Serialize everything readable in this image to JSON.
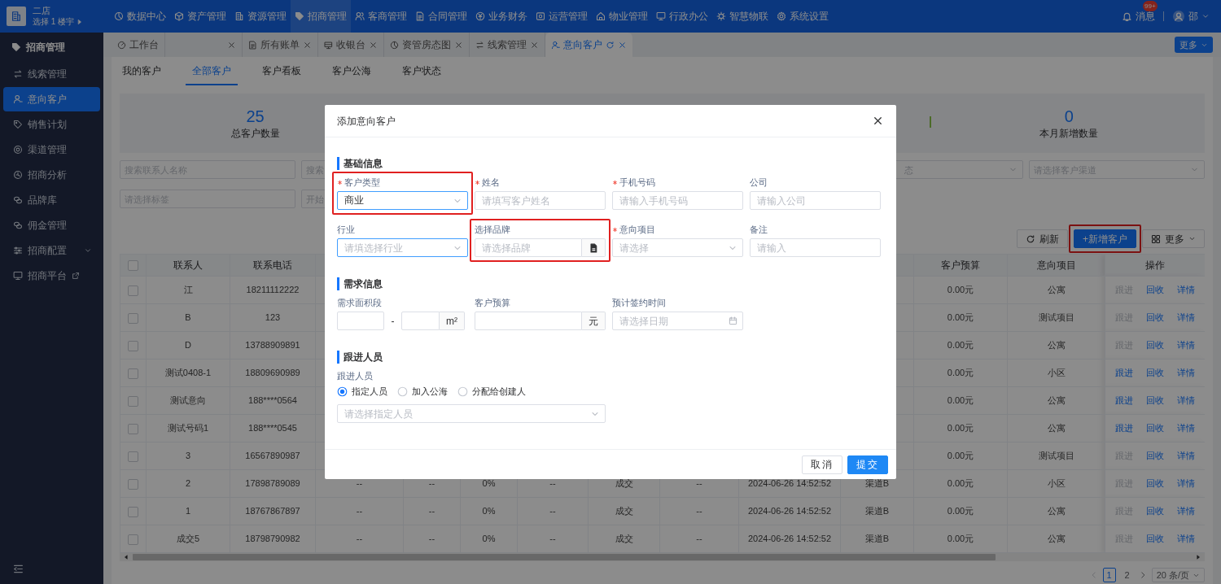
{
  "header": {
    "store": "二店",
    "building_selector": "选择 1 楼宇"
  },
  "top_nav": [
    {
      "label": "数据中心",
      "selected": false
    },
    {
      "label": "资产管理",
      "selected": false
    },
    {
      "label": "资源管理",
      "selected": false
    },
    {
      "label": "招商管理",
      "selected": true
    },
    {
      "label": "客商管理",
      "selected": false
    },
    {
      "label": "合同管理",
      "selected": false
    },
    {
      "label": "业务财务",
      "selected": false
    },
    {
      "label": "运营管理",
      "selected": false
    },
    {
      "label": "物业管理",
      "selected": false
    },
    {
      "label": "行政办公",
      "selected": false
    },
    {
      "label": "智慧物联",
      "selected": false
    },
    {
      "label": "系统设置",
      "selected": false
    }
  ],
  "user_area": {
    "messages": "消息",
    "badge": "99+",
    "user": "邵"
  },
  "sidebar": {
    "title": "招商管理",
    "items": [
      {
        "label": "线索管理",
        "selected": false
      },
      {
        "label": "意向客户",
        "selected": true
      },
      {
        "label": "销售计划",
        "selected": false
      },
      {
        "label": "渠道管理",
        "selected": false
      },
      {
        "label": "招商分析",
        "selected": false
      },
      {
        "label": "品牌库",
        "selected": false
      },
      {
        "label": "佣金管理",
        "selected": false
      },
      {
        "label": "招商配置",
        "selected": false,
        "submenu": true
      },
      {
        "label": "招商平台",
        "selected": false,
        "external": true
      }
    ]
  },
  "page_tabs": [
    {
      "label": "工作台",
      "selected": false,
      "closable": false
    },
    {
      "selected": false,
      "closable": true
    },
    {
      "label": "所有账单",
      "selected": false,
      "closable": true
    },
    {
      "label": "收银台",
      "selected": false,
      "closable": true
    },
    {
      "label": "资管房态图",
      "selected": false,
      "closable": true
    },
    {
      "label": "线索管理",
      "selected": false,
      "closable": true
    },
    {
      "label": "意向客户",
      "selected": true,
      "closable": true,
      "refresh": true
    }
  ],
  "tabs_more": "更多",
  "sub_tabs": [
    {
      "label": "我的客户",
      "selected": false
    },
    {
      "label": "全部客户",
      "selected": true
    },
    {
      "label": "客户看板",
      "selected": false
    },
    {
      "label": "客户公海",
      "selected": false
    },
    {
      "label": "客户状态",
      "selected": false
    }
  ],
  "stats": [
    {
      "value": "25",
      "label": "总客户数量"
    },
    {
      "value": "0",
      "label": "本月新增数量"
    }
  ],
  "filters": [
    [
      {
        "kind": "input",
        "placeholder": "搜索联系人名称"
      },
      {
        "kind": "input",
        "placeholder": "搜索"
      },
      {
        "kind": "select",
        "placeholder": "态",
        "clipped": true
      },
      {
        "kind": "select",
        "placeholder": "请选择客户渠道"
      }
    ],
    [
      {
        "kind": "input",
        "placeholder": "请选择标签"
      },
      {
        "kind": "input",
        "placeholder": "开始"
      }
    ]
  ],
  "toolbar": {
    "refresh": "刷新",
    "add": {
      "label": "+新增客户",
      "annotated": true
    },
    "more": "更多"
  },
  "table": {
    "select_all_checked": false,
    "columns": [
      {
        "label": "联系人"
      },
      {
        "label": "联系电话"
      },
      {},
      {},
      {},
      {},
      {},
      {},
      {},
      {},
      {
        "label": "客户预算"
      },
      {
        "label": "意向项目"
      },
      {
        "label": "操作"
      }
    ],
    "rows": [
      {
        "checked": false,
        "cells": [
          "江",
          "18211112222",
          null,
          null,
          null,
          null,
          null,
          null,
          null,
          null,
          "0.00元",
          "公寓"
        ],
        "actions": [
          {
            "label": "跟进",
            "disabled": true
          },
          {
            "label": "回收",
            "disabled": false
          },
          {
            "label": "详情",
            "disabled": false
          }
        ]
      },
      {
        "checked": false,
        "cells": [
          "B",
          "123",
          null,
          null,
          null,
          null,
          null,
          null,
          null,
          null,
          "0.00元",
          "测试项目"
        ],
        "actions": [
          {
            "label": "跟进",
            "disabled": true
          },
          {
            "label": "回收",
            "disabled": false
          },
          {
            "label": "详情",
            "disabled": false
          }
        ]
      },
      {
        "checked": false,
        "cells": [
          "D",
          "13788909891",
          null,
          null,
          null,
          null,
          null,
          null,
          null,
          null,
          "0.00元",
          "公寓"
        ],
        "actions": [
          {
            "label": "跟进",
            "disabled": true
          },
          {
            "label": "回收",
            "disabled": false
          },
          {
            "label": "详情",
            "disabled": false
          }
        ]
      },
      {
        "checked": false,
        "cells": [
          "测试0408-1",
          "18809690989",
          null,
          null,
          null,
          null,
          null,
          null,
          null,
          null,
          "0.00元",
          "小区"
        ],
        "actions": [
          {
            "label": "跟进",
            "disabled": false
          },
          {
            "label": "回收",
            "disabled": false
          },
          {
            "label": "详情",
            "disabled": false
          }
        ]
      },
      {
        "checked": false,
        "cells": [
          "测试意向",
          "188****0564",
          null,
          null,
          null,
          null,
          null,
          null,
          null,
          null,
          "0.00元",
          "公寓"
        ],
        "actions": [
          {
            "label": "跟进",
            "disabled": false
          },
          {
            "label": "回收",
            "disabled": false
          },
          {
            "label": "详情",
            "disabled": false
          }
        ]
      },
      {
        "checked": false,
        "cells": [
          "测试号码1",
          "188****0545",
          null,
          null,
          null,
          null,
          null,
          null,
          null,
          null,
          "0.00元",
          "公寓"
        ],
        "actions": [
          {
            "label": "跟进",
            "disabled": false
          },
          {
            "label": "回收",
            "disabled": false
          },
          {
            "label": "详情",
            "disabled": false
          }
        ]
      },
      {
        "checked": false,
        "cells": [
          "3",
          "16567890987",
          null,
          null,
          null,
          null,
          null,
          null,
          null,
          null,
          "0.00元",
          "测试项目"
        ],
        "actions": [
          {
            "label": "跟进",
            "disabled": true
          },
          {
            "label": "回收",
            "disabled": false
          },
          {
            "label": "详情",
            "disabled": false
          }
        ]
      },
      {
        "checked": false,
        "cells": [
          "2",
          "17898789089",
          "--",
          "--",
          "0%",
          "--",
          "成交",
          "--",
          "2024-06-26 14:52:52",
          "渠道B",
          "0.00元",
          "小区"
        ],
        "actions": [
          {
            "label": "跟进",
            "disabled": true
          },
          {
            "label": "回收",
            "disabled": false
          },
          {
            "label": "详情",
            "disabled": false
          }
        ]
      },
      {
        "checked": false,
        "cells": [
          "1",
          "18767867897",
          "--",
          "--",
          "0%",
          "--",
          "成交",
          "--",
          "2024-06-26 14:52:52",
          "渠道B",
          "0.00元",
          "公寓"
        ],
        "actions": [
          {
            "label": "跟进",
            "disabled": true
          },
          {
            "label": "回收",
            "disabled": false
          },
          {
            "label": "详情",
            "disabled": false
          }
        ]
      },
      {
        "checked": false,
        "cells": [
          "成交5",
          "18798790982",
          "--",
          "--",
          "0%",
          "--",
          "成交",
          "--",
          "2024-06-26 14:52:52",
          "渠道B",
          "0.00元",
          "公寓"
        ],
        "actions": [
          {
            "label": "跟进",
            "disabled": true
          },
          {
            "label": "回收",
            "disabled": false
          },
          {
            "label": "详情",
            "disabled": false
          }
        ]
      }
    ]
  },
  "pagination": {
    "pages": [
      {
        "label": "1",
        "selected": true
      },
      {
        "label": "2",
        "selected": false
      }
    ],
    "page_size": "20 条/页"
  },
  "dialog": {
    "title": "添加意向客户",
    "sections": [
      {
        "title": "基础信息",
        "fields": [
          {
            "kind": "select",
            "label": "客户类型",
            "required": true,
            "value": "商业",
            "highlighted": true,
            "annotated": true
          },
          {
            "kind": "input",
            "label": "姓名",
            "required": true,
            "placeholder": "请填写客户姓名"
          },
          {
            "kind": "input",
            "label": "手机号码",
            "required": true,
            "placeholder": "请输入手机号码"
          },
          {
            "kind": "input",
            "label": "公司",
            "placeholder": "请输入公司"
          },
          {
            "kind": "select",
            "label": "行业",
            "placeholder": "请填选择行业",
            "highlighted": true
          },
          {
            "kind": "picker",
            "label": "选择品牌",
            "placeholder": "请选择品牌",
            "annotated": true
          },
          {
            "kind": "select",
            "label": "意向项目",
            "required": true,
            "placeholder": "请选择"
          },
          {
            "kind": "input",
            "label": "备注",
            "placeholder": "请输入"
          }
        ]
      },
      {
        "title": "需求信息",
        "fields": [
          {
            "kind": "range",
            "label": "需求面积段",
            "separator": "-",
            "unit": "m²"
          },
          {
            "kind": "unit",
            "label": "客户预算",
            "unit": "元"
          },
          {
            "kind": "date",
            "label": "预计签约时间",
            "placeholder": "请选择日期"
          }
        ]
      },
      {
        "title": "跟进人员",
        "fields": [
          {
            "kind": "radio",
            "label": "跟进人员",
            "options": [
              {
                "label": "指定人员",
                "selected": true
              },
              {
                "label": "加入公海",
                "selected": false
              },
              {
                "label": "分配给创建人",
                "selected": false
              }
            ]
          },
          {
            "kind": "select",
            "placeholder": "请选择指定人员",
            "wide": true
          }
        ]
      }
    ],
    "buttons": [
      {
        "label": "取消",
        "kind": "secondary"
      },
      {
        "label": "提交",
        "kind": "primary"
      }
    ]
  }
}
